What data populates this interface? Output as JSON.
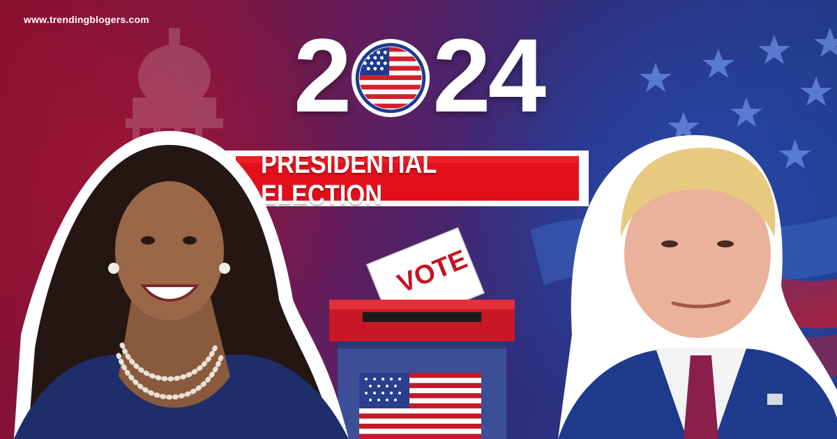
{
  "watermark": "www.trendingblogers.com",
  "headline": {
    "year_left": "2",
    "year_right": "24",
    "flag_circle_icon": "us-flag-circle-icon"
  },
  "banner": {
    "text": "PRESIDENTIAL ELECTION",
    "color": "#e3101c"
  },
  "ballot_box": {
    "card_text": "VOTE",
    "box_color": "#b5121b"
  },
  "colors": {
    "left_bg": "#8a1030",
    "right_bg": "#1f3d8c",
    "white": "#ffffff"
  }
}
